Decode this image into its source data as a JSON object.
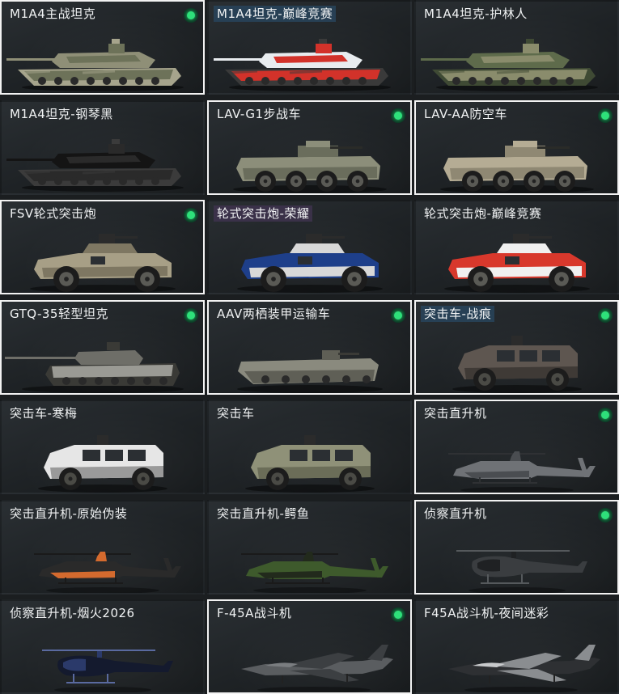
{
  "cards": [
    {
      "name": "M1A4主战坦克",
      "kind": "tank",
      "owned": true,
      "highlight": "none",
      "colors": [
        "#8f8f77",
        "#6d7259",
        "#a6a48c"
      ]
    },
    {
      "name": "M1A4坦克-巅峰竞赛",
      "kind": "tank",
      "owned": false,
      "highlight": "blue",
      "colors": [
        "#e8ecef",
        "#d2322a",
        "#3a3a3a"
      ]
    },
    {
      "name": "M1A4坦克-护林人",
      "kind": "tank",
      "owned": false,
      "highlight": "none",
      "colors": [
        "#5e6b4b",
        "#8a8c6c",
        "#3f4a34"
      ]
    },
    {
      "name": "M1A4坦克-钢琴黑",
      "kind": "tank",
      "owned": false,
      "highlight": "none",
      "colors": [
        "#141414",
        "#2a2a2a",
        "#3b3b3b"
      ]
    },
    {
      "name": "LAV-G1步战车",
      "kind": "apc",
      "owned": true,
      "highlight": "none",
      "colors": [
        "#8c8e7a",
        "#6a6d5c",
        "#2a2b28"
      ]
    },
    {
      "name": "LAV-AA防空车",
      "kind": "apc",
      "owned": true,
      "highlight": "none",
      "colors": [
        "#b5ac94",
        "#8f8873",
        "#2a2b28"
      ]
    },
    {
      "name": "FSV轮式突击炮",
      "kind": "armored",
      "owned": true,
      "highlight": "none",
      "colors": [
        "#a79f86",
        "#7e7762",
        "#2b2b2b"
      ]
    },
    {
      "name": "轮式突击炮-荣耀",
      "kind": "armored",
      "owned": false,
      "highlight": "purple",
      "colors": [
        "#1e3f8a",
        "#d8d8d8",
        "#2b2b2b"
      ]
    },
    {
      "name": "轮式突击炮-巅峰竞赛",
      "kind": "armored",
      "owned": false,
      "highlight": "none",
      "colors": [
        "#d8382c",
        "#f0f0f0",
        "#2b2b2b"
      ]
    },
    {
      "name": "GTQ-35轻型坦克",
      "kind": "lighttank",
      "owned": true,
      "highlight": "none",
      "colors": [
        "#9a9a94",
        "#6e6e68",
        "#3a3a36"
      ]
    },
    {
      "name": "AAV两栖装甲运输车",
      "kind": "aav",
      "owned": true,
      "highlight": "none",
      "colors": [
        "#8a8a7e",
        "#5f5f56",
        "#3a3a36"
      ]
    },
    {
      "name": "突击车-战痕",
      "kind": "mrap",
      "owned": true,
      "highlight": "blue",
      "colors": [
        "#5e5650",
        "#3f3a36",
        "#2b2b2b"
      ]
    },
    {
      "name": "突击车-寒梅",
      "kind": "mrap",
      "owned": false,
      "highlight": "none",
      "colors": [
        "#e6e6e6",
        "#9a9a9a",
        "#2b2b2b"
      ]
    },
    {
      "name": "突击车",
      "kind": "mrap",
      "owned": false,
      "highlight": "none",
      "colors": [
        "#8f9178",
        "#6b6d58",
        "#2b2b2b"
      ]
    },
    {
      "name": "突击直升机",
      "kind": "heli",
      "owned": true,
      "highlight": "none",
      "colors": [
        "#6f7276",
        "#4a4d51",
        "#2f3134"
      ]
    },
    {
      "name": "突击直升机-原始伪装",
      "kind": "heli",
      "owned": false,
      "highlight": "none",
      "colors": [
        "#2a2a2a",
        "#d46a2e",
        "#1a1a1a"
      ]
    },
    {
      "name": "突击直升机-鳄鱼",
      "kind": "heli",
      "owned": false,
      "highlight": "none",
      "colors": [
        "#3e5a2c",
        "#222a1c",
        "#1a1a1a"
      ]
    },
    {
      "name": "侦察直升机",
      "kind": "scout",
      "owned": true,
      "highlight": "none",
      "colors": [
        "#3a3d40",
        "#1f2123",
        "#55595c"
      ]
    },
    {
      "name": "侦察直升机-烟火2026",
      "kind": "scout",
      "owned": false,
      "highlight": "none",
      "colors": [
        "#141a2e",
        "#2b3a6a",
        "#5a6aa0"
      ]
    },
    {
      "name": "F-45A战斗机",
      "kind": "jet",
      "owned": true,
      "highlight": "none",
      "colors": [
        "#5a5d60",
        "#3c3f42",
        "#7a7d80"
      ]
    },
    {
      "name": "F45A战斗机-夜间迷彩",
      "kind": "jet",
      "owned": false,
      "highlight": "none",
      "colors": [
        "#2e3033",
        "#8a8d90",
        "#c8cacc"
      ]
    }
  ],
  "accent": {
    "owned_dot": "#2ee07a",
    "owned_border": "#f2f2f2"
  }
}
